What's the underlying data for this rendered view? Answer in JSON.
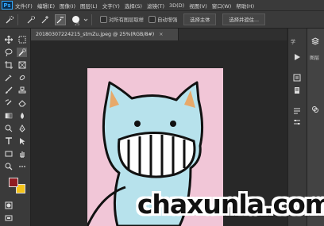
{
  "app": {
    "logo_text": "Ps"
  },
  "menu": [
    {
      "label": "文件(F)"
    },
    {
      "label": "编辑(E)"
    },
    {
      "label": "图像(I)"
    },
    {
      "label": "图层(L)"
    },
    {
      "label": "文字(Y)"
    },
    {
      "label": "选择(S)"
    },
    {
      "label": "滤镜(T)"
    },
    {
      "label": "3D(D)"
    },
    {
      "label": "视图(V)"
    },
    {
      "label": "窗口(W)"
    },
    {
      "label": "帮助(H)"
    }
  ],
  "options": {
    "brush_size": "25",
    "sample_all_layers": "对所有图层取样",
    "auto_enhance": "自动增强",
    "select_subject": "选择主体",
    "select_and_mask": "选择并遮住..."
  },
  "document_tab": {
    "title": "20180307224215_stmZu.jpeg @ 25%(RGB/8#)",
    "close": "×"
  },
  "colors": {
    "foreground": "#8f1c22",
    "background": "#f4c31a",
    "canvas_pink": "#f1c6d7",
    "cat_blue": "#b7e2ec"
  },
  "right_panel": {
    "label_1": "学",
    "label_2": "图层"
  },
  "watermark": {
    "text": "chaxunla.com"
  }
}
